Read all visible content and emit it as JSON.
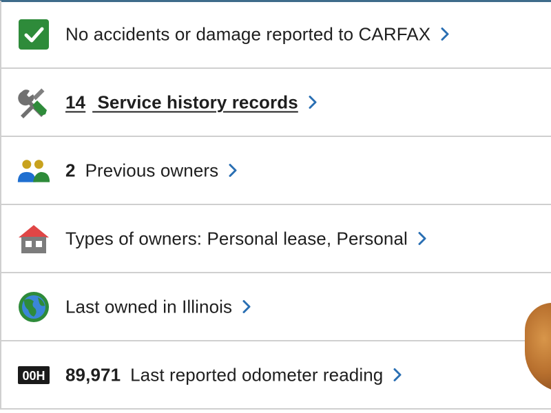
{
  "rows": [
    {
      "icon": "check-box-icon",
      "text": "No accidents or damage reported to CARFAX"
    },
    {
      "icon": "wrench-screwdriver-icon",
      "number": "14",
      "text": " Service history records"
    },
    {
      "icon": "owners-icon",
      "number": "2",
      "text": "Previous owners"
    },
    {
      "icon": "house-icon",
      "text": "Types of owners: Personal lease, Personal"
    },
    {
      "icon": "globe-icon",
      "text": "Last owned in Illinois"
    },
    {
      "icon": "odometer-icon",
      "number": "89,971",
      "text": "Last reported odometer reading"
    }
  ],
  "odometer_icon_text": "00H",
  "colors": {
    "check_green": "#2e8b3a",
    "chevron_blue": "#2a6fb3",
    "owner_gold": "#c8a21e",
    "owner_blue": "#1f6fd0",
    "owner_green": "#2e8b3a",
    "roof_red": "#e04646",
    "house_gray": "#7c7c7c",
    "globe_blue": "#3b86d8",
    "globe_green": "#2e8b3a"
  }
}
